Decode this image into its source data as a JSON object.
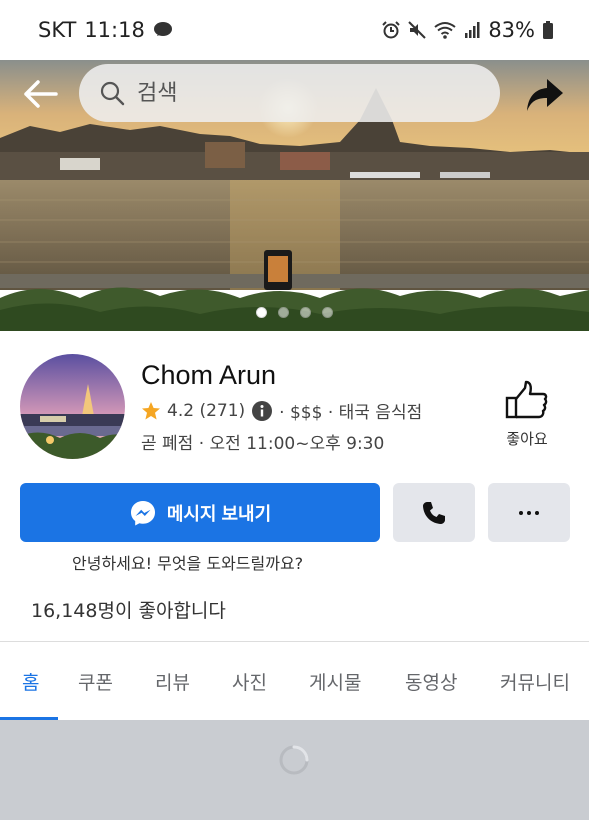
{
  "status_bar": {
    "carrier": "SKT",
    "time": "11:18",
    "battery": "83%"
  },
  "header": {
    "search_placeholder": "검색"
  },
  "page": {
    "name": "Chom Arun",
    "rating": "4.2 (271)",
    "price_category": "· $$$ · 태국 음식점",
    "hours": "곧 폐점 · 오전 11:00~오후 9:30",
    "like_label": "좋아요"
  },
  "actions": {
    "message_label": "메시지 보내기",
    "greeting": "안녕하세요! 무엇을 도와드릴까요?"
  },
  "stats": {
    "likes": "16,148명이 좋아합니다"
  },
  "tabs": [
    {
      "label": "홈",
      "active": true
    },
    {
      "label": "쿠폰"
    },
    {
      "label": "리뷰"
    },
    {
      "label": "사진"
    },
    {
      "label": "게시물"
    },
    {
      "label": "동영상"
    },
    {
      "label": "커뮤니티"
    }
  ],
  "carousel": {
    "count": 4,
    "active_index": 0
  },
  "colors": {
    "brand_blue": "#1b74e4",
    "button_gray": "#e4e6eb",
    "star": "#f5a623"
  },
  "icons": [
    "back-arrow-icon",
    "search-icon",
    "share-icon",
    "star-icon",
    "info-icon",
    "thumbs-up-icon",
    "messenger-icon",
    "phone-icon",
    "more-icon",
    "loading-spinner-icon"
  ]
}
